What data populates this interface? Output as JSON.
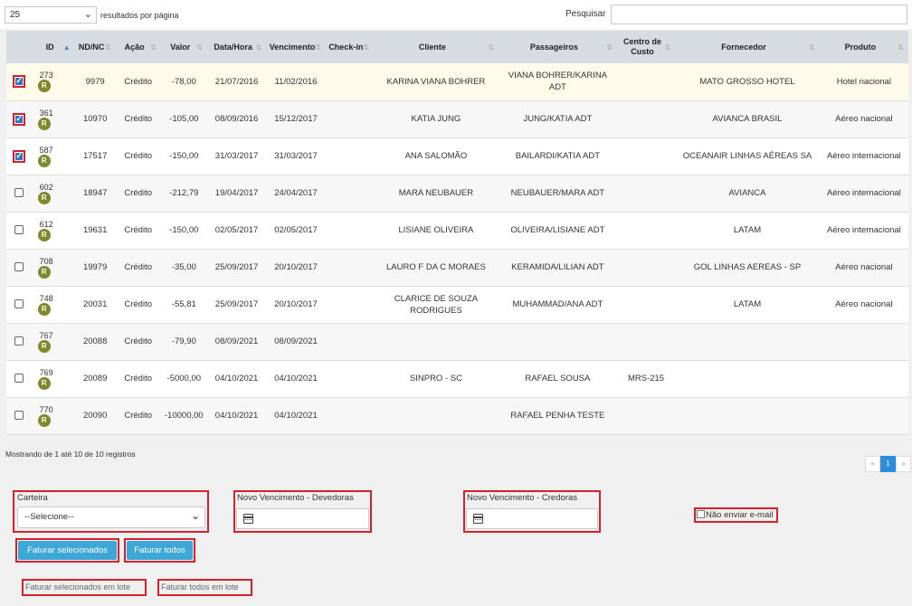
{
  "top": {
    "page_size": "25",
    "page_size_suffix": "resultados por página",
    "search_label": "Pesquisar"
  },
  "table": {
    "headers": [
      "",
      "ID",
      "ND/NC",
      "Ação",
      "Valor",
      "Data/Hora",
      "Vencimento",
      "Check-in",
      "Cliente",
      "Passageiros",
      "Centro de Custo",
      "Fornecedor",
      "Produto"
    ],
    "badge": "R",
    "rows": [
      {
        "checked": true,
        "id": "273",
        "nd": "9979",
        "acao": "Crédito",
        "valor": "-78,00",
        "data": "21/07/2016",
        "venc": "11/02/2016",
        "checkin": "",
        "cliente": "KARINA VIANA BOHRER",
        "pass": "VIANA BOHRER/KARINA ADT",
        "cc": "",
        "forn": "MATO GROSSO HOTEL",
        "prod": "Hotel nacional"
      },
      {
        "checked": true,
        "id": "361",
        "nd": "10970",
        "acao": "Crédito",
        "valor": "-105,00",
        "data": "08/09/2016",
        "venc": "15/12/2017",
        "checkin": "",
        "cliente": "KATIA JUNG",
        "pass": "JUNG/KATIA ADT",
        "cc": "",
        "forn": "AVIANCA BRASIL",
        "prod": "Aéreo nacional"
      },
      {
        "checked": true,
        "id": "587",
        "nd": "17517",
        "acao": "Crédito",
        "valor": "-150,00",
        "data": "31/03/2017",
        "venc": "31/03/2017",
        "checkin": "",
        "cliente": "ANA SALOMÃO",
        "pass": "BAILARDI/KATIA ADT",
        "cc": "",
        "forn": "OCEANAIR LINHAS AÉREAS SA",
        "prod": "Aéreo internacional"
      },
      {
        "checked": false,
        "id": "602",
        "nd": "18947",
        "acao": "Crédito",
        "valor": "-212,79",
        "data": "19/04/2017",
        "venc": "24/04/2017",
        "checkin": "",
        "cliente": "MARA NEUBAUER",
        "pass": "NEUBAUER/MARA ADT",
        "cc": "",
        "forn": "AVIANCA",
        "prod": "Aéreo internacional"
      },
      {
        "checked": false,
        "id": "612",
        "nd": "19631",
        "acao": "Crédito",
        "valor": "-150,00",
        "data": "02/05/2017",
        "venc": "02/05/2017",
        "checkin": "",
        "cliente": "LISIANE OLIVEIRA",
        "pass": "OLIVEIRA/LISIANE ADT",
        "cc": "",
        "forn": "LATAM",
        "prod": "Aéreo internacional"
      },
      {
        "checked": false,
        "id": "708",
        "nd": "19979",
        "acao": "Crédito",
        "valor": "-35,00",
        "data": "25/09/2017",
        "venc": "20/10/2017",
        "checkin": "",
        "cliente": "LAURO F DA C MORAES",
        "pass": "KERAMIDA/LILIAN ADT",
        "cc": "",
        "forn": "GOL LINHAS AEREAS - SP",
        "prod": "Aéreo nacional"
      },
      {
        "checked": false,
        "id": "748",
        "nd": "20031",
        "acao": "Crédito",
        "valor": "-55,81",
        "data": "25/09/2017",
        "venc": "20/10/2017",
        "checkin": "",
        "cliente": "CLARICE DE SOUZA RODRIGUES",
        "pass": "MUHAMMAD/ANA ADT",
        "cc": "",
        "forn": "LATAM",
        "prod": "Aéreo nacional"
      },
      {
        "checked": false,
        "id": "767",
        "nd": "20088",
        "acao": "Crédito",
        "valor": "-79,90",
        "data": "08/09/2021",
        "venc": "08/09/2021",
        "checkin": "",
        "cliente": "",
        "pass": "",
        "cc": "",
        "forn": "",
        "prod": ""
      },
      {
        "checked": false,
        "id": "769",
        "nd": "20089",
        "acao": "Crédito",
        "valor": "-5000,00",
        "data": "04/10/2021",
        "venc": "04/10/2021",
        "checkin": "",
        "cliente": "SINPRO - SC",
        "pass": "RAFAEL SOUSA",
        "cc": "MRS-215",
        "forn": "",
        "prod": ""
      },
      {
        "checked": false,
        "id": "770",
        "nd": "20090",
        "acao": "Crédito",
        "valor": "-10000,00",
        "data": "04/10/2021",
        "venc": "04/10/2021",
        "checkin": "",
        "cliente": "",
        "pass": "RAFAEL PENHA TESTE",
        "cc": "",
        "forn": "",
        "prod": ""
      }
    ]
  },
  "footer": {
    "showing": "Mostrando de 1 até 10 de 10 registros",
    "pager": {
      "prev": "«",
      "current": "1",
      "next": "»"
    }
  },
  "form": {
    "carteira_label": "Carteira",
    "carteira_value": "--Selecione--",
    "venc_dev_label": "Novo Vencimento - Devedoras",
    "venc_cred_label": "Novo Vencimento - Credoras",
    "no_email_label": "Não enviar e-mail",
    "btn_fat_sel": "Faturar selecionados",
    "btn_fat_todos": "Faturar todos",
    "btn_fat_sel_lote": "Faturar selecionados em lote",
    "btn_fat_todos_lote": "Faturar todos em lote"
  },
  "colors": {
    "header_bg": "#d7dbe2",
    "accent_blue": "#3da8d8",
    "highlight_red": "#d8202a",
    "badge_olive": "#80892a"
  }
}
